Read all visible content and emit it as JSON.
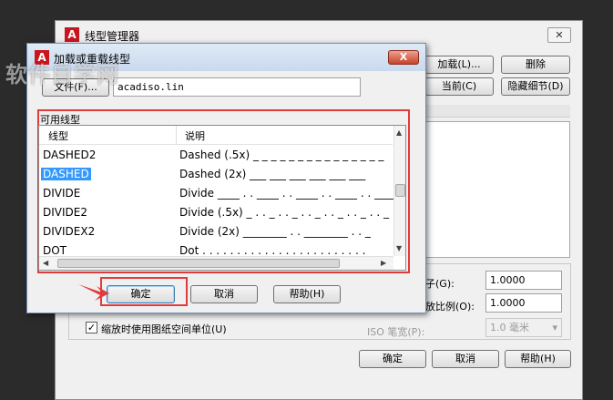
{
  "main": {
    "title": "线型管理器",
    "buttons": {
      "load": "加载(L)...",
      "delete": "删除",
      "current": "当前(C)",
      "hide_details": "隐藏细节(D)"
    },
    "details": {
      "global_scale_label": "子(G):",
      "global_scale_value": "1.0000",
      "current_scale_label": "放比例(O):",
      "current_scale_value": "1.0000",
      "iso_pen_width_label": "ISO 笔宽(P):",
      "iso_pen_width_value": "1.0 毫米",
      "paper_space_checkbox_label": "缩放时使用图纸空间单位(U)"
    },
    "footer": {
      "ok": "确定",
      "cancel": "取消",
      "help": "帮助(H)"
    }
  },
  "watermark": "软件自学网",
  "dialog": {
    "title": "加载或重载线型",
    "close_glyph": "X",
    "file_button": "文件(F)...",
    "file_value": "acadiso.lin",
    "available_label": "可用线型",
    "columns": {
      "linetype": "线型",
      "description": "说明"
    },
    "rows": [
      {
        "name": "DASHED2",
        "desc": "Dashed (.5x) _ _ _ _ _ _ _ _ _ _ _ _ _ _ _"
      },
      {
        "name": "DASHED",
        "desc": "Dashed (2x) ___  ___  ___  ___  ___  ___"
      },
      {
        "name": "DIVIDE",
        "desc": "Divide ____ . . ____ . . ____ . . ____ . . ____"
      },
      {
        "name": "DIVIDE2",
        "desc": "Divide (.5x) _ . . _ . . _ . . _ . . _ . . _ . . _"
      },
      {
        "name": "DIVIDEX2",
        "desc": "Divide (2x) ________  .  .  ________  .  .  _"
      },
      {
        "name": "DOT",
        "desc": "Dot . . . . . . . . . . . . . . . . . . . . . . . ."
      }
    ],
    "selected_index": 1,
    "buttons": {
      "ok": "确定",
      "cancel": "取消",
      "help": "帮助(H)"
    }
  },
  "colors": {
    "highlight_red": "#e23b3b",
    "selection_blue": "#3399ff"
  }
}
